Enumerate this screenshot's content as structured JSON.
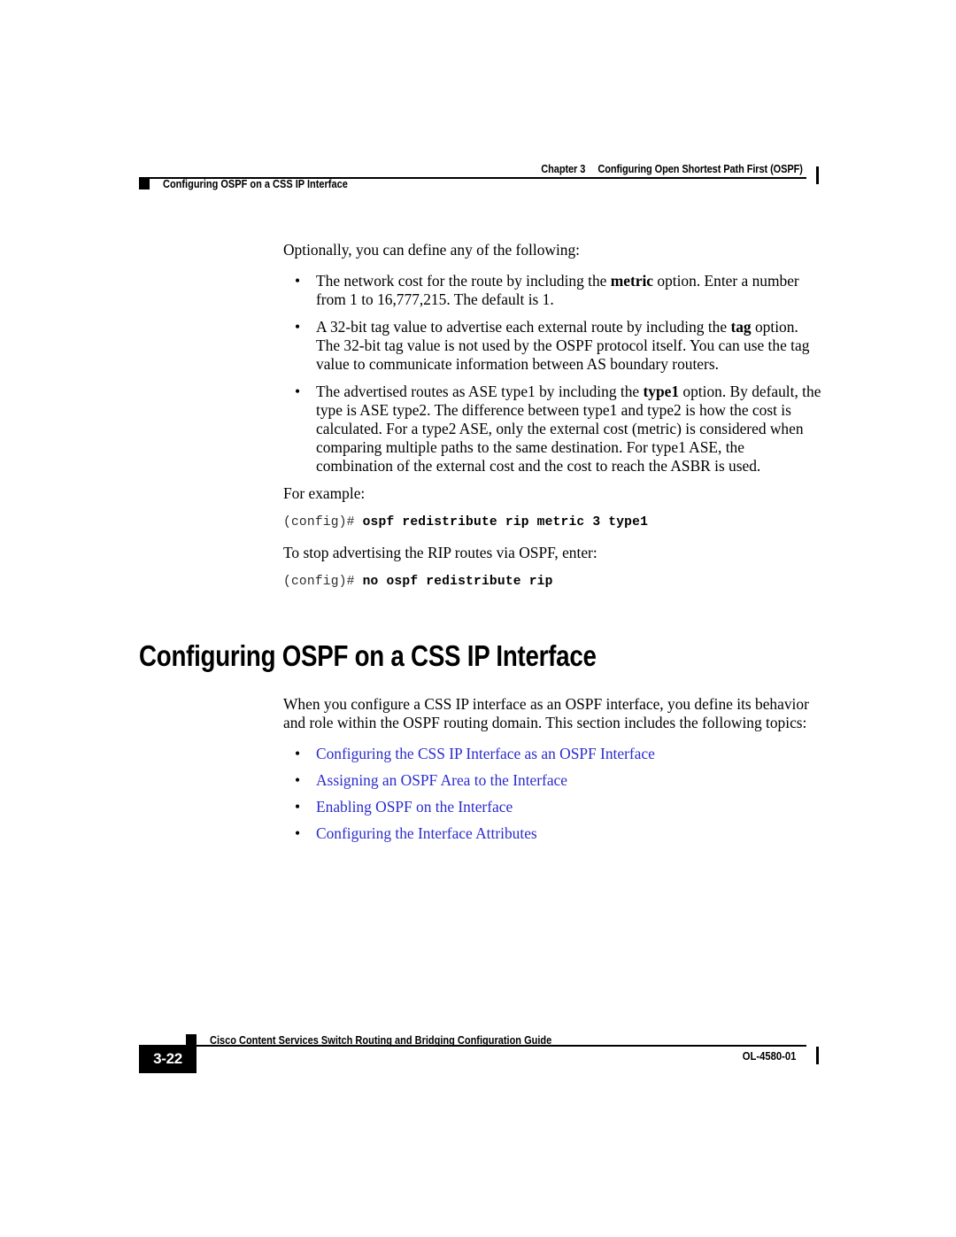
{
  "page": {
    "background_color": "#ffffff",
    "text_color": "#000000",
    "link_color": "#2b2bcf"
  },
  "running_head": {
    "chapter_number": "Chapter 3",
    "chapter_title": "Configuring Open Shortest Path First (OSPF)",
    "section_title": "Configuring OSPF on a CSS IP Interface"
  },
  "body": {
    "intro_paragraph": "Optionally, you can define any of the following:",
    "option_bullets": [
      {
        "text_before": "The network cost for the route by including the ",
        "keyword": "metric",
        "text_after": " option. Enter a number from 1 to 16,777,215. The default is 1."
      },
      {
        "text_before": "A 32-bit tag value to advertise each external route by including the ",
        "keyword": "tag",
        "text_after": " option. The 32-bit tag value is not used by the OSPF protocol itself. You can use the tag value to communicate information between AS boundary routers."
      },
      {
        "text_before": "The advertised routes as ASE type1 by including the ",
        "keyword": "type1",
        "text_after": " option. By default, the type is ASE type2. The difference between type1 and type2 is how the cost is calculated. For a type2 ASE, only the external cost (metric) is considered when comparing multiple paths to the same destination. For type1 ASE, the combination of the external cost and the cost to reach the ASBR is used."
      }
    ],
    "example_label": "For example:",
    "command_1": {
      "prompt": "(config)# ",
      "command": "ospf redistribute rip metric 3 type1"
    },
    "stop_advertising_label": "To stop advertising the RIP routes via OSPF, enter:",
    "command_2": {
      "prompt": "(config)# ",
      "command": "no ospf redistribute rip"
    }
  },
  "section": {
    "heading": "Configuring OSPF on a CSS IP Interface",
    "intro_paragraph": "When you configure a CSS IP interface as an OSPF interface, you define its behavior and role within the OSPF routing domain. This section includes the following topics:",
    "topic_links": [
      "Configuring the CSS IP Interface as an OSPF Interface",
      "Assigning an OSPF Area to the Interface",
      "Enabling OSPF on the Interface",
      "Configuring the Interface Attributes"
    ]
  },
  "footer": {
    "page_number": "3-22",
    "guide_title": "Cisco Content Services Switch Routing and Bridging Configuration Guide",
    "document_number": "OL-4580-01"
  },
  "glyphs": {
    "bullet": "•"
  }
}
